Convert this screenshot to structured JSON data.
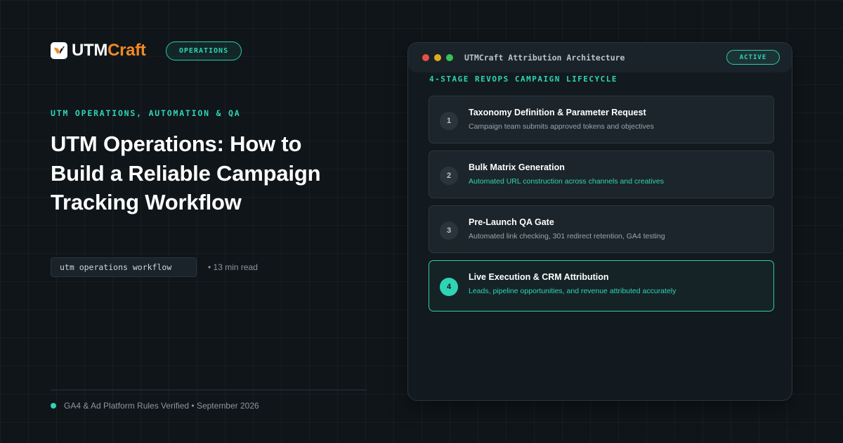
{
  "brand": {
    "name_prefix": "UTM",
    "name_suffix": "Craft",
    "accent_color": "#f28a24"
  },
  "category_pill": "OPERATIONS",
  "eyebrow": "UTM OPERATIONS, AUTOMATION & QA",
  "headline": "UTM Operations: How to Build a Reliable Campaign Tracking Workflow",
  "tag": "utm operations workflow",
  "read_time": "• 13 min read",
  "footer": "GA4 & Ad Platform Rules Verified • September 2026",
  "panel": {
    "title": "UTMCraft Attribution Architecture",
    "status": "ACTIVE",
    "section_title": "4-STAGE REVOPS CAMPAIGN LIFECYCLE",
    "stages": [
      {
        "number": "1",
        "title": "Taxonomy Definition & Parameter Request",
        "description": "Campaign team submits approved tokens and objectives"
      },
      {
        "number": "2",
        "title": "Bulk Matrix Generation",
        "description": "Automated URL construction across channels and creatives"
      },
      {
        "number": "3",
        "title": "Pre-Launch QA Gate",
        "description": "Automated link checking, 301 redirect retention, GA4 testing"
      },
      {
        "number": "4",
        "title": "Live Execution & CRM Attribution",
        "description": "Leads, pipeline opportunities, and revenue attributed accurately"
      }
    ]
  },
  "colors": {
    "teal": "#2fd4b5",
    "background": "#0f1519",
    "window_dots": [
      "#ea4f44",
      "#e3a91d",
      "#35c25a"
    ]
  }
}
